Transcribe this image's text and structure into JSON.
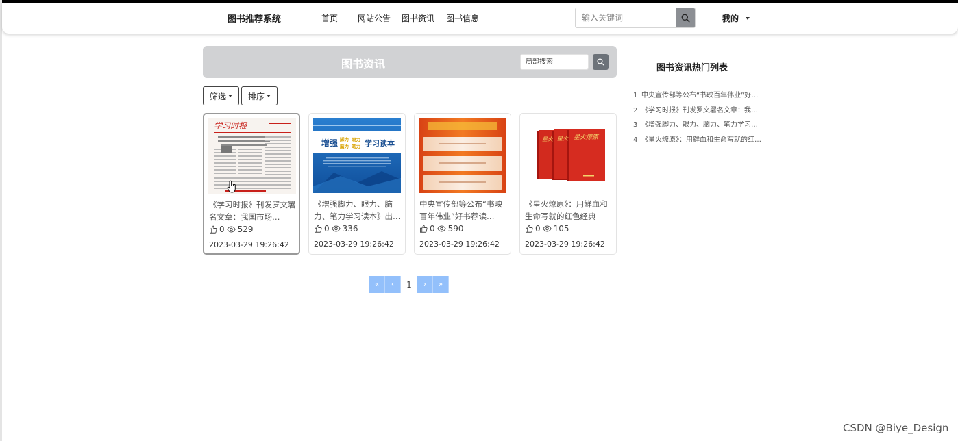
{
  "navbar": {
    "brand": "图书推荐系统",
    "items": [
      {
        "label": "首页"
      },
      {
        "label": "网站公告"
      },
      {
        "label": "图书资讯"
      },
      {
        "label": "图书信息"
      }
    ],
    "search_placeholder": "输入关键词",
    "user_label": "我的"
  },
  "banner": {
    "title": "图书资讯",
    "search_placeholder": "局部搜索"
  },
  "filters": {
    "filter_label": "筛选",
    "sort_label": "排序"
  },
  "cards": [
    {
      "title": "《学习时报》刊发罗文署名文章：我国市场…",
      "likes": "0",
      "views": "529",
      "date": "2023-03-29 19:26:42",
      "image": "newspaper-thumbnail"
    },
    {
      "title": "《增强脚力、眼力、脑力、笔力学习读本》出…",
      "likes": "0",
      "views": "336",
      "date": "2023-03-29 19:26:42",
      "image": "blue-book-cover"
    },
    {
      "title": "中央宣传部等公布“书映百年伟业”好书荐读…",
      "likes": "0",
      "views": "590",
      "date": "2023-03-29 19:26:42",
      "image": "orange-poster"
    },
    {
      "title": "《星火燎原》：用鲜血和生命写就的红色经典",
      "likes": "0",
      "views": "105",
      "date": "2023-03-29 19:26:42",
      "image": "red-book-set"
    }
  ],
  "thumb_text": {
    "newspaper_masthead": "学习时报",
    "book2_title": "学习读本",
    "book2_words": [
      "脚力",
      "眼力",
      "脑力",
      "笔力"
    ],
    "book4_title": "星火燎原"
  },
  "pagination": {
    "first": "«",
    "prev": "‹",
    "current": "1",
    "next": "›",
    "last": "»"
  },
  "hot": {
    "title": "图书资讯热门列表",
    "items": [
      {
        "index": "1",
        "text": "中央宣传部等公布“书映百年伟业”好书荐读"
      },
      {
        "index": "2",
        "text": "《学习时报》刊发罗文署名文章：我国市场"
      },
      {
        "index": "3",
        "text": "《增强脚力、眼力、脑力、笔力学习读本》"
      },
      {
        "index": "4",
        "text": "《星火燎原》：用鲜血和生命写就的红色经典"
      }
    ]
  },
  "watermark": "CSDN @Biye_Design",
  "colors": {
    "pagination_accent": "#93c0fb",
    "banner_bg": "#d1d2d4",
    "search_button": "#8c8f94"
  }
}
